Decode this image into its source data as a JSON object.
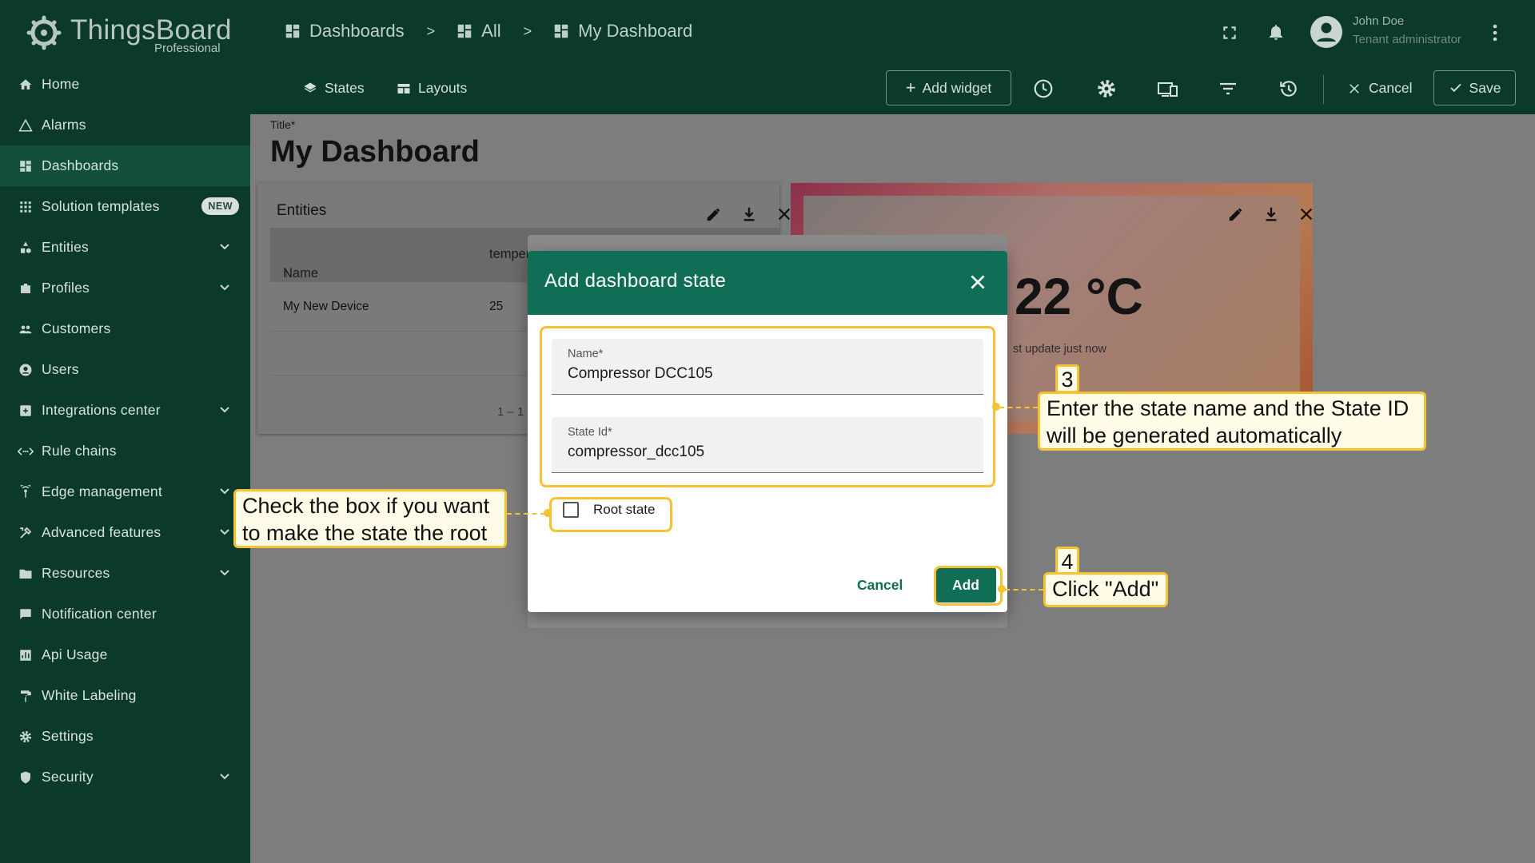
{
  "app": {
    "name": "ThingsBoard",
    "edition": "Professional"
  },
  "sidebar": {
    "items": [
      {
        "label": "Home",
        "icon": "home-icon"
      },
      {
        "label": "Alarms",
        "icon": "alarm-icon"
      },
      {
        "label": "Dashboards",
        "icon": "dashboard-icon",
        "active": true
      },
      {
        "label": "Solution templates",
        "icon": "apps-icon",
        "badge": "NEW"
      },
      {
        "label": "Entities",
        "icon": "entities-icon",
        "expandable": true
      },
      {
        "label": "Profiles",
        "icon": "profiles-icon",
        "expandable": true
      },
      {
        "label": "Customers",
        "icon": "customers-icon"
      },
      {
        "label": "Users",
        "icon": "user-icon"
      },
      {
        "label": "Integrations center",
        "icon": "integrations-icon",
        "expandable": true
      },
      {
        "label": "Rule chains",
        "icon": "rule-chains-icon"
      },
      {
        "label": "Edge management",
        "icon": "edge-icon",
        "expandable": true
      },
      {
        "label": "Advanced features",
        "icon": "tools-icon",
        "expandable": true
      },
      {
        "label": "Resources",
        "icon": "folder-icon",
        "expandable": true
      },
      {
        "label": "Notification center",
        "icon": "notification-icon"
      },
      {
        "label": "Api Usage",
        "icon": "chart-icon"
      },
      {
        "label": "White Labeling",
        "icon": "paint-roller-icon"
      },
      {
        "label": "Settings",
        "icon": "settings-icon"
      },
      {
        "label": "Security",
        "icon": "security-icon",
        "expandable": true
      }
    ]
  },
  "header": {
    "breadcrumbs": [
      "Dashboards",
      "All",
      "My Dashboard"
    ],
    "separator": ">",
    "user": {
      "name": "John Doe",
      "role": "Tenant administrator"
    }
  },
  "toolbar": {
    "states_label": "States",
    "layouts_label": "Layouts",
    "add_widget_label": "Add widget",
    "cancel_label": "Cancel",
    "save_label": "Save"
  },
  "dashboard": {
    "title_label": "Title*",
    "title_value": "My Dashboard",
    "entities_widget": {
      "title": "Entities",
      "columns": [
        "Name",
        "temper"
      ],
      "rows": [
        {
          "name": "My New Device",
          "temperature": "25"
        }
      ],
      "pagination": "1 – 1 c"
    },
    "temperature_widget": {
      "value": "22 °C",
      "updated": "st update just now"
    }
  },
  "dialog": {
    "title": "Add dashboard state",
    "name_label": "Name*",
    "name_value": "Compressor DCC105",
    "state_id_label": "State Id*",
    "state_id_value": "compressor_dcc105",
    "root_state_label": "Root state",
    "root_state_checked": false,
    "cancel_label": "Cancel",
    "add_label": "Add"
  },
  "annotations": {
    "step3_number": "3",
    "step3_text_line1": "Enter the state name and the State ID",
    "step3_text_line2": "will be generated automatically",
    "checkbox_note_line1": "Check the box if you want",
    "checkbox_note_line2": "to make the state the root",
    "step4_number": "4",
    "step4_text": "Click \"Add\""
  },
  "colors": {
    "sidebar_bg": "#0b3a2c",
    "primary": "#0f6e55",
    "highlight": "#f5c233"
  }
}
